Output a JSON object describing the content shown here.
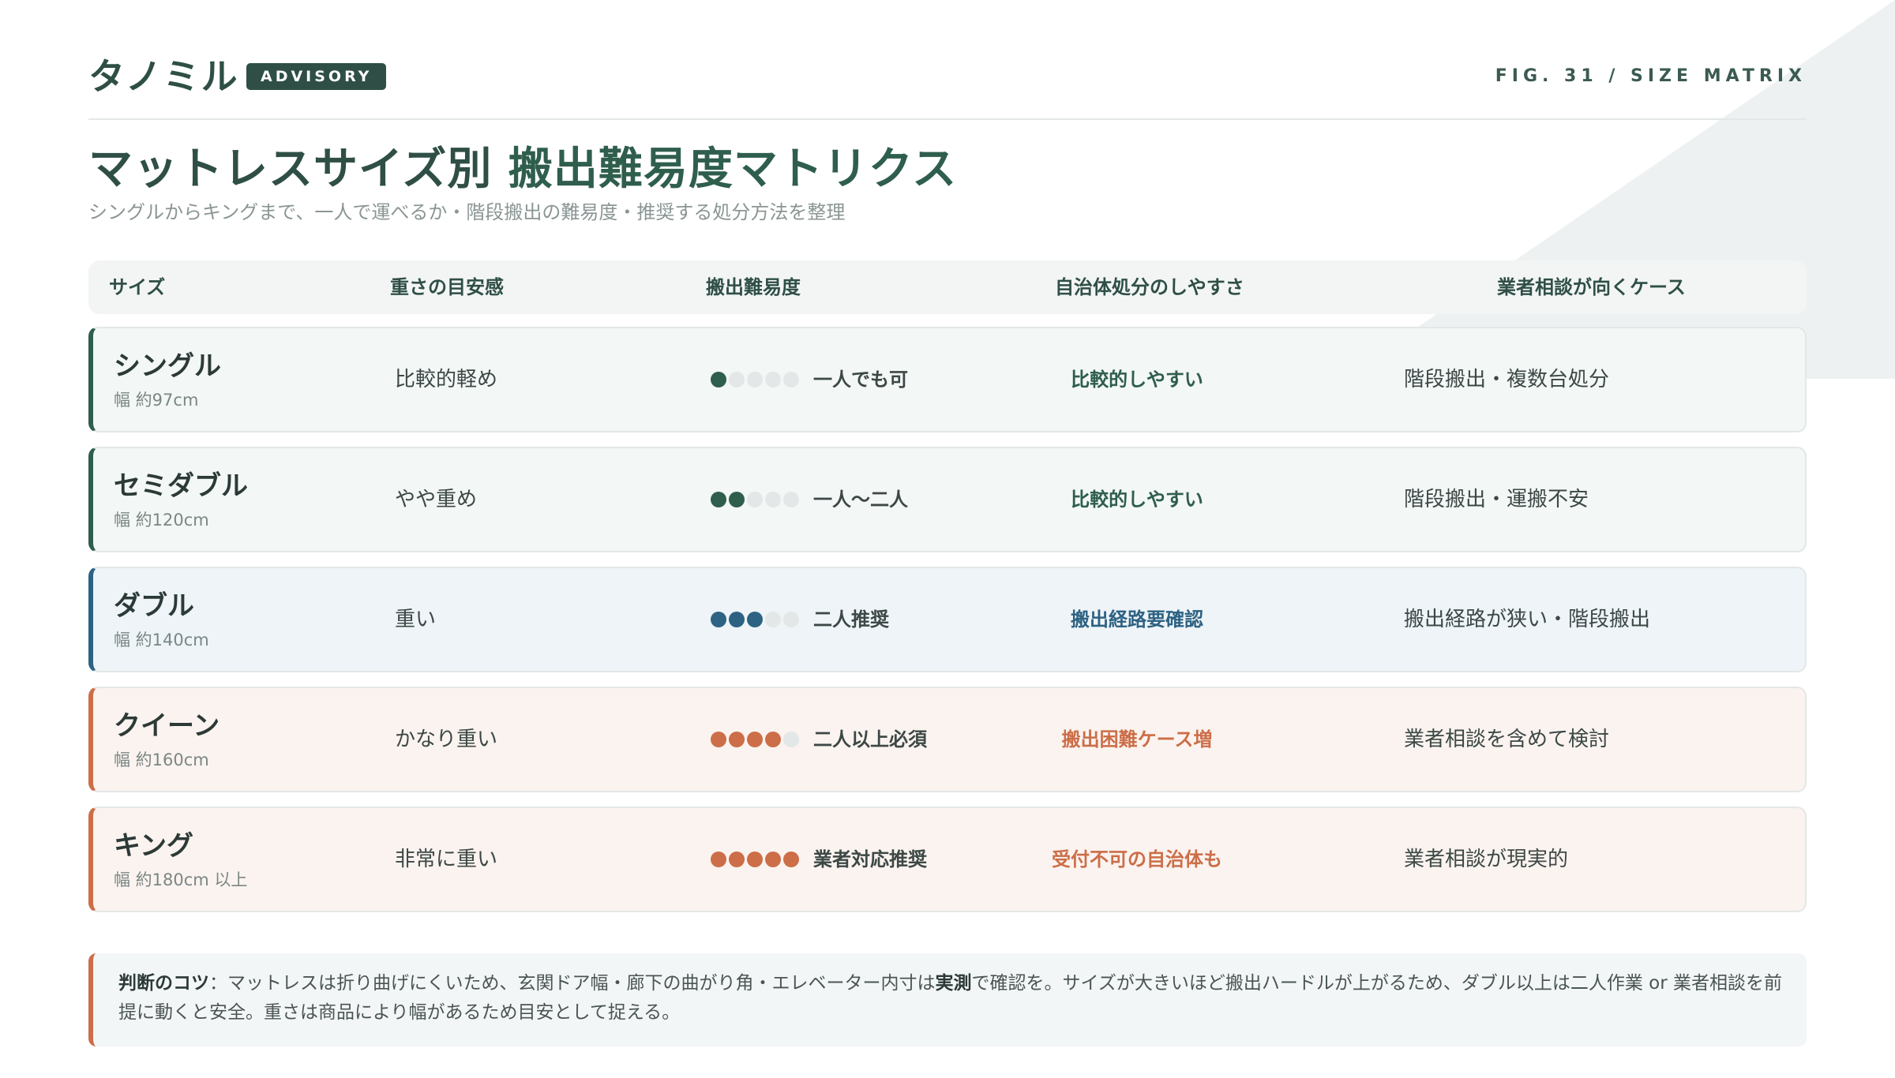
{
  "brand": {
    "logo": "タノミル",
    "badge": "ADVISORY",
    "fig": "FIG. 31 / SIZE MATRIX"
  },
  "title": {
    "prefix": "マットレスサイズ別 ",
    "highlight": "搬出難易度マトリクス"
  },
  "subtitle": "シングルからキングまで、一人で運べるか・階段搬出の難易度・推奨する処分方法を整理",
  "headers": [
    "サイズ",
    "重さの目安感",
    "搬出難易度",
    "自治体処分のしやすさ",
    "業者相談が向くケース"
  ],
  "colors": {
    "green": "#2f5e4d",
    "blue": "#2d6283",
    "orange": "#cc6e48",
    "empty_dot": "#e4e7e7"
  },
  "rows": [
    {
      "name": "シングル",
      "width": "幅 約97cm",
      "weight": "比較的軽め",
      "difficulty": 1,
      "difficulty_label": "一人でも可",
      "municipal": "比較的しやすい",
      "case": "階段搬出・複数台処分",
      "tone": "green"
    },
    {
      "name": "セミダブル",
      "width": "幅 約120cm",
      "weight": "やや重め",
      "difficulty": 2,
      "difficulty_label": "一人〜二人",
      "municipal": "比較的しやすい",
      "case": "階段搬出・運搬不安",
      "tone": "green"
    },
    {
      "name": "ダブル",
      "width": "幅 約140cm",
      "weight": "重い",
      "difficulty": 3,
      "difficulty_label": "二人推奨",
      "municipal": "搬出経路要確認",
      "case": "搬出経路が狭い・階段搬出",
      "tone": "blue"
    },
    {
      "name": "クイーン",
      "width": "幅 約160cm",
      "weight": "かなり重い",
      "difficulty": 4,
      "difficulty_label": "二人以上必須",
      "municipal": "搬出困難ケース増",
      "case": "業者相談を含めて検討",
      "tone": "orange"
    },
    {
      "name": "キング",
      "width": "幅 約180cm 以上",
      "weight": "非常に重い",
      "difficulty": 5,
      "difficulty_label": "業者対応推奨",
      "municipal": "受付不可の自治体も",
      "case": "業者相談が現実的",
      "tone": "orange"
    }
  ],
  "note": {
    "label": "判断のコツ",
    "text1": "：マットレスは折り曲げにくいため、玄関ドア幅・廊下の曲がり角・エレベーター内寸は",
    "emph": "実測",
    "text2": "で確認を。サイズが大きいほど搬出ハードルが上がるため、ダブル以上は二人作業 or 業者相談を前提に動くと安全。重さは商品により幅があるため目安として捉える。"
  }
}
